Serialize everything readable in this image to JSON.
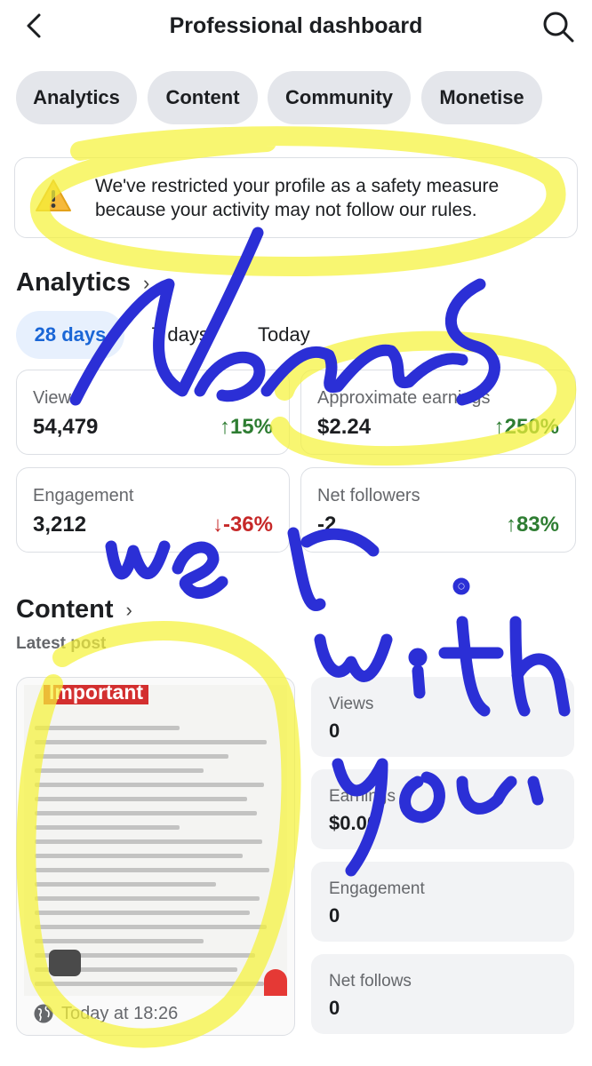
{
  "header": {
    "title": "Professional dashboard",
    "back_icon": "chevron-left-icon",
    "search_icon": "search-icon"
  },
  "tabs": [
    {
      "label": "Analytics"
    },
    {
      "label": "Content"
    },
    {
      "label": "Community"
    },
    {
      "label": "Monetise"
    }
  ],
  "alert": {
    "icon": "warning-icon",
    "text_line1": "We've restricted your profile as a safety measure",
    "text_line2": "because your activity may not follow our rules."
  },
  "analytics": {
    "title": "Analytics",
    "periods": [
      {
        "label": "28 days",
        "active": true
      },
      {
        "label": "7 days"
      },
      {
        "label": "Today"
      }
    ],
    "metrics": [
      {
        "label": "Views",
        "value": "54,479",
        "change": "↑15%",
        "direction": "up"
      },
      {
        "label": "Approximate earnings",
        "value": "$2.24",
        "change": "↑250%",
        "direction": "up"
      },
      {
        "label": "Engagement",
        "value": "3,212",
        "change": "↓-36%",
        "direction": "down"
      },
      {
        "label": "Net followers",
        "value": "-2",
        "change": "↑83%",
        "direction": "up"
      }
    ]
  },
  "content": {
    "title": "Content",
    "subtitle": "Latest post",
    "post": {
      "banner": "Important",
      "time": "Today at 18:26",
      "time_icon": "globe-icon"
    },
    "stats": [
      {
        "label": "Views",
        "value": "0"
      },
      {
        "label": "Earnings",
        "value": "$0.00"
      },
      {
        "label": "Engagement",
        "value": "0"
      },
      {
        "label": "Net follows",
        "value": "0"
      }
    ]
  },
  "colors": {
    "accent": "#1a66d6",
    "positive": "#2e7d32",
    "negative": "#c62828",
    "highlighter": "#f5f23a",
    "ink": "#2b2fd6"
  }
}
